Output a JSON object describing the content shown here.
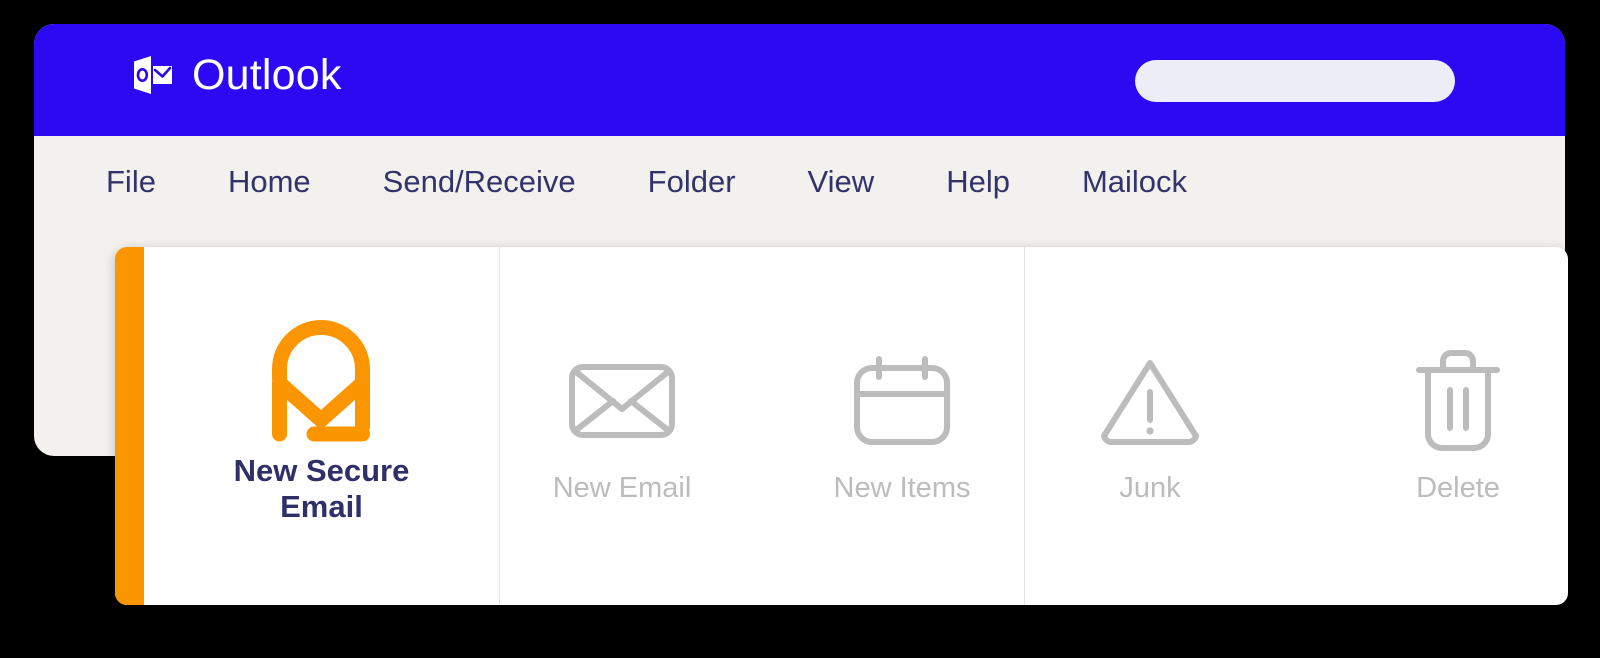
{
  "window": {
    "brand_name": "Outlook",
    "brand_logo_icon": "outlook-logo-icon",
    "accent_blue": "#2b09f2",
    "chrome_background": "#f2f1ee"
  },
  "search": {
    "value": "",
    "placeholder": ""
  },
  "menubar": {
    "items": [
      {
        "label": "File"
      },
      {
        "label": "Home"
      },
      {
        "label": "Send/Receive"
      },
      {
        "label": "Folder"
      },
      {
        "label": "View"
      },
      {
        "label": "Help"
      },
      {
        "label": "Mailock"
      }
    ]
  },
  "ribbon": {
    "accent_color": "#fb9500",
    "primary": {
      "label": "New Secure\nEmail",
      "icon": "mailock-padlock-envelope-icon",
      "icon_color": "#fb9500",
      "label_color": "#2f3068"
    },
    "groups": [
      {
        "name": "new",
        "buttons": [
          {
            "label": "New Email",
            "icon": "envelope-icon"
          },
          {
            "label": "New Items",
            "icon": "calendar-icon"
          }
        ]
      },
      {
        "name": "actions",
        "buttons": [
          {
            "label": "Junk",
            "icon": "warning-triangle-icon"
          },
          {
            "label": "Delete",
            "icon": "trash-icon"
          }
        ]
      }
    ],
    "muted_color": "#bcbcbc"
  }
}
